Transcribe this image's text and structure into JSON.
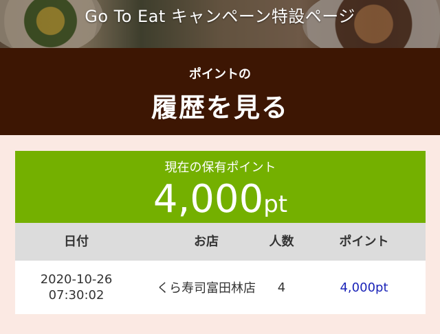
{
  "banner": {
    "title": "Go To Eat キャンペーン特設ページ"
  },
  "heading": {
    "subtitle": "ポイントの",
    "title": "履歴を見る"
  },
  "points": {
    "label": "現在の保有ポイント",
    "value": "4,000",
    "unit": "pt"
  },
  "table": {
    "headers": {
      "date": "日付",
      "shop": "お店",
      "people": "人数",
      "points": "ポイント"
    },
    "rows": [
      {
        "date": "2020-10-26",
        "time": "07:30:02",
        "shop": "くら寿司富田林店",
        "people": "4",
        "points": "4,000pt"
      }
    ]
  },
  "colors": {
    "heading_bg": "#3d1603",
    "points_bg": "#74b000",
    "table_header_bg": "#dcdcdc",
    "page_bg": "#fbe9e3",
    "points_link": "#1a23b8"
  }
}
